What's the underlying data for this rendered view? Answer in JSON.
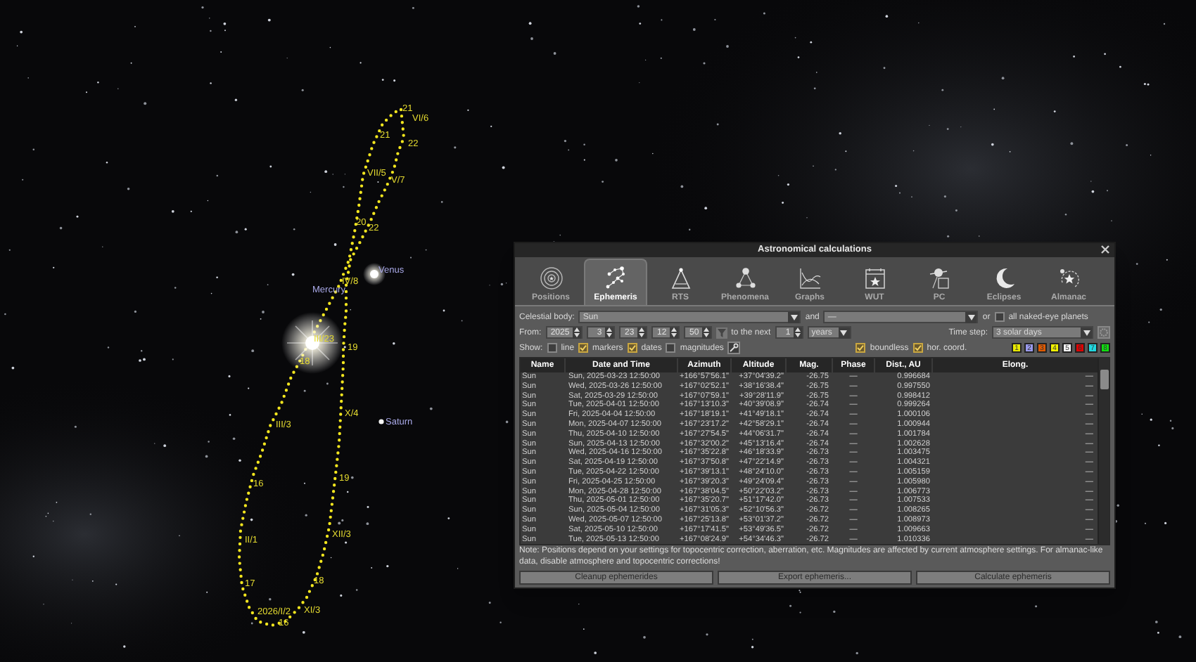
{
  "sky": {
    "labels": [
      {
        "kind": "date",
        "text": "21"
      },
      {
        "kind": "date",
        "text": "VI/6"
      },
      {
        "kind": "date",
        "text": "21"
      },
      {
        "kind": "date",
        "text": "22"
      },
      {
        "kind": "date",
        "text": "VII/5"
      },
      {
        "kind": "date",
        "text": "V/7"
      },
      {
        "kind": "date",
        "text": "20"
      },
      {
        "kind": "date",
        "text": "22"
      },
      {
        "kind": "planet",
        "text": "Venus"
      },
      {
        "kind": "date",
        "text": "IV/8"
      },
      {
        "kind": "planet",
        "text": "Mercury"
      },
      {
        "kind": "date",
        "text": "III/23"
      },
      {
        "kind": "date",
        "text": "19"
      },
      {
        "kind": "date",
        "text": "18"
      },
      {
        "kind": "date",
        "text": "X/4"
      },
      {
        "kind": "date",
        "text": "III/3"
      },
      {
        "kind": "planet",
        "text": "Saturn"
      },
      {
        "kind": "date",
        "text": "19"
      },
      {
        "kind": "date",
        "text": "16"
      },
      {
        "kind": "date",
        "text": "XII/3"
      },
      {
        "kind": "date",
        "text": "II/1"
      },
      {
        "kind": "date",
        "text": "18"
      },
      {
        "kind": "date",
        "text": "17"
      },
      {
        "kind": "date",
        "text": "XI/3"
      },
      {
        "kind": "date",
        "text": "2026/I/2"
      },
      {
        "kind": "date",
        "text": "16"
      }
    ]
  },
  "dialog": {
    "title": "Astronomical calculations",
    "tabs": [
      {
        "label": "Positions",
        "selected": false
      },
      {
        "label": "Ephemeris",
        "selected": true
      },
      {
        "label": "RTS",
        "selected": false
      },
      {
        "label": "Phenomena",
        "selected": false
      },
      {
        "label": "Graphs",
        "selected": false
      },
      {
        "label": "WUT",
        "selected": false
      },
      {
        "label": "PC",
        "selected": false
      },
      {
        "label": "Eclipses",
        "selected": false
      },
      {
        "label": "Almanac",
        "selected": false
      }
    ],
    "celestial_body": {
      "label": "Celestial body:",
      "value": "Sun",
      "and": "and",
      "second_value": "—",
      "or": "or",
      "all_planets": {
        "label": "all naked-eye planets",
        "checked": false
      }
    },
    "from": {
      "label": "From:",
      "fields": [
        "2025",
        "3",
        "23",
        "12",
        "50"
      ],
      "to_next": "to the next",
      "count": "1",
      "unit": "years"
    },
    "time_step": {
      "label": "Time step:",
      "value": "3 solar days"
    },
    "show": {
      "label": "Show:",
      "options": [
        {
          "label": "line",
          "checked": false
        },
        {
          "label": "markers",
          "checked": true
        },
        {
          "label": "dates",
          "checked": true
        },
        {
          "label": "magnitudes",
          "checked": false
        }
      ],
      "extra_options": [
        {
          "label": "boundless",
          "checked": true
        },
        {
          "label": "hor. coord.",
          "checked": true
        }
      ]
    },
    "swatches": [
      {
        "label": "1",
        "color": "#e8e800"
      },
      {
        "label": "2",
        "color": "#9a9aee"
      },
      {
        "label": "3",
        "color": "#e05a00"
      },
      {
        "label": "4",
        "color": "#f0f000"
      },
      {
        "label": "5",
        "color": "#f4f4f4"
      },
      {
        "label": "6",
        "color": "#e00000"
      },
      {
        "label": "7",
        "color": "#20d8e0"
      },
      {
        "label": "8",
        "color": "#10e010"
      }
    ],
    "table": {
      "columns": [
        "Name",
        "Date and Time",
        "Azimuth",
        "Altitude",
        "Mag.",
        "Phase",
        "Dist., AU",
        "Elong."
      ],
      "rows": [
        [
          "Sun",
          "Sun, 2025-03-23 12:50:00",
          "+166°57'56.1\"",
          "+37°04'39.2\"",
          "-26.75",
          "—",
          "0.996684",
          "—"
        ],
        [
          "Sun",
          "Wed, 2025-03-26 12:50:00",
          "+167°02'52.1\"",
          "+38°16'38.4\"",
          "-26.75",
          "—",
          "0.997550",
          "—"
        ],
        [
          "Sun",
          "Sat, 2025-03-29 12:50:00",
          "+167°07'59.1\"",
          "+39°28'11.9\"",
          "-26.75",
          "—",
          "0.998412",
          "—"
        ],
        [
          "Sun",
          "Tue, 2025-04-01 12:50:00",
          "+167°13'10.3\"",
          "+40°39'08.9\"",
          "-26.74",
          "—",
          "0.999264",
          "—"
        ],
        [
          "Sun",
          "Fri, 2025-04-04 12:50:00",
          "+167°18'19.1\"",
          "+41°49'18.1\"",
          "-26.74",
          "—",
          "1.000106",
          "—"
        ],
        [
          "Sun",
          "Mon, 2025-04-07 12:50:00",
          "+167°23'17.2\"",
          "+42°58'29.1\"",
          "-26.74",
          "—",
          "1.000944",
          "—"
        ],
        [
          "Sun",
          "Thu, 2025-04-10 12:50:00",
          "+167°27'54.5\"",
          "+44°06'31.7\"",
          "-26.74",
          "—",
          "1.001784",
          "—"
        ],
        [
          "Sun",
          "Sun, 2025-04-13 12:50:00",
          "+167°32'00.2\"",
          "+45°13'16.4\"",
          "-26.74",
          "—",
          "1.002628",
          "—"
        ],
        [
          "Sun",
          "Wed, 2025-04-16 12:50:00",
          "+167°35'22.8\"",
          "+46°18'33.9\"",
          "-26.73",
          "—",
          "1.003475",
          "—"
        ],
        [
          "Sun",
          "Sat, 2025-04-19 12:50:00",
          "+167°37'50.8\"",
          "+47°22'14.9\"",
          "-26.73",
          "—",
          "1.004321",
          "—"
        ],
        [
          "Sun",
          "Tue, 2025-04-22 12:50:00",
          "+167°39'13.1\"",
          "+48°24'10.0\"",
          "-26.73",
          "—",
          "1.005159",
          "—"
        ],
        [
          "Sun",
          "Fri, 2025-04-25 12:50:00",
          "+167°39'20.3\"",
          "+49°24'09.4\"",
          "-26.73",
          "—",
          "1.005980",
          "—"
        ],
        [
          "Sun",
          "Mon, 2025-04-28 12:50:00",
          "+167°38'04.5\"",
          "+50°22'03.2\"",
          "-26.73",
          "—",
          "1.006773",
          "—"
        ],
        [
          "Sun",
          "Thu, 2025-05-01 12:50:00",
          "+167°35'20.7\"",
          "+51°17'42.0\"",
          "-26.73",
          "—",
          "1.007533",
          "—"
        ],
        [
          "Sun",
          "Sun, 2025-05-04 12:50:00",
          "+167°31'05.3\"",
          "+52°10'56.3\"",
          "-26.72",
          "—",
          "1.008265",
          "—"
        ],
        [
          "Sun",
          "Wed, 2025-05-07 12:50:00",
          "+167°25'13.8\"",
          "+53°01'37.2\"",
          "-26.72",
          "—",
          "1.008973",
          "—"
        ],
        [
          "Sun",
          "Sat, 2025-05-10 12:50:00",
          "+167°17'41.5\"",
          "+53°49'36.5\"",
          "-26.72",
          "—",
          "1.009663",
          "—"
        ],
        [
          "Sun",
          "Tue, 2025-05-13 12:50:00",
          "+167°08'24.9\"",
          "+54°34'46.3\"",
          "-26.72",
          "—",
          "1.010336",
          "—"
        ]
      ]
    },
    "note": "Note: Positions depend on your settings for topocentric correction, aberration, etc. Magnitudes are affected by current atmosphere settings. For almanac-like data, disable atmosphere and topocentric corrections!",
    "buttons": [
      "Cleanup ephemerides",
      "Export ephemeris...",
      "Calculate ephemeris"
    ]
  }
}
